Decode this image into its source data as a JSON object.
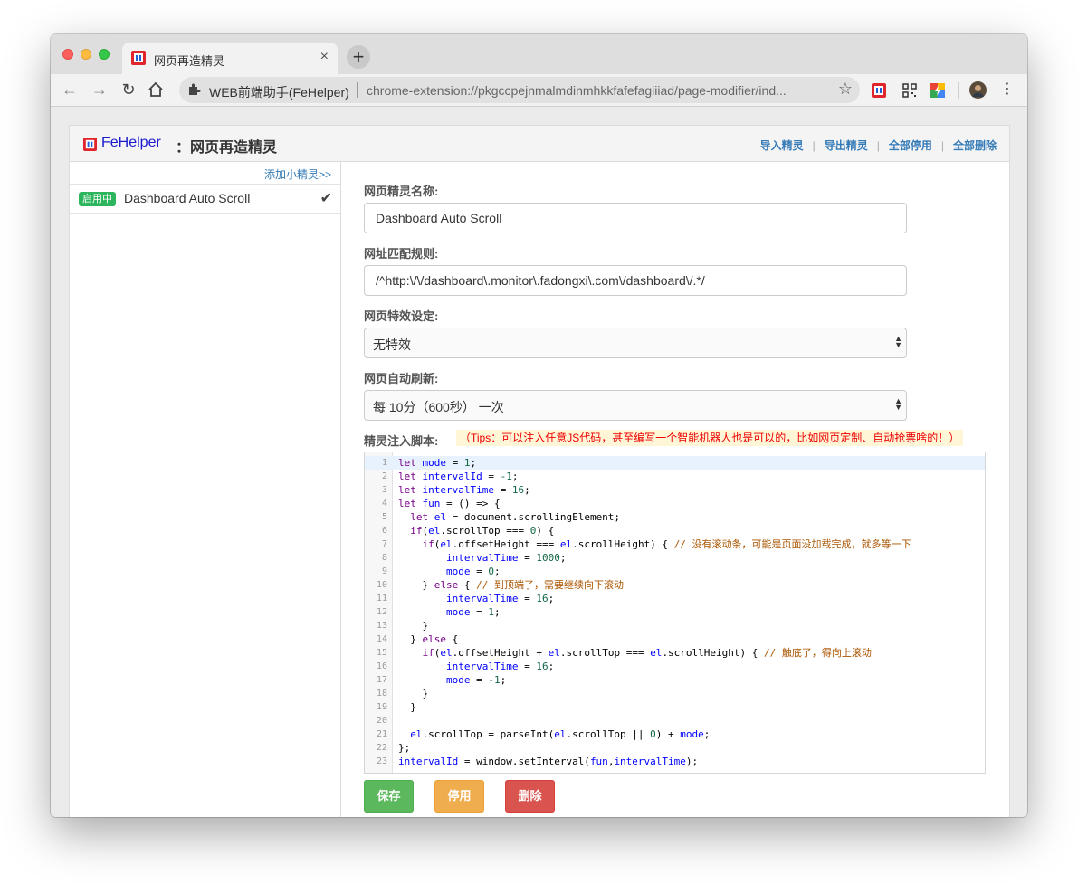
{
  "browser": {
    "tab_title": "网页再造精灵",
    "tab_close": "×",
    "new_tab": "+",
    "address": {
      "site_name": "WEB前端助手(FeHelper)",
      "url": "chrome-extension://pkgccpejnmalmdinmhkkfafefagiiiad/page-modifier/ind..."
    }
  },
  "header": {
    "brand": "FeHelper",
    "title": "：网页再造精灵",
    "links": [
      "导入精灵",
      "导出精灵",
      "全部停用",
      "全部删除"
    ]
  },
  "sidebar": {
    "add_link": "添加小精灵>>",
    "items": [
      {
        "badge": "启用中",
        "name": "Dashboard Auto Scroll",
        "check": "✔"
      }
    ]
  },
  "form": {
    "name_label": "网页精灵名称:",
    "name_value": "Dashboard Auto Scroll",
    "url_label": "网址匹配规则:",
    "url_value": "/^http:\\/\\/dashboard\\.monitor\\.fadongxi\\.com\\/dashboard\\/.*/",
    "effect_label": "网页特效设定:",
    "effect_value": "无特效",
    "refresh_label": "网页自动刷新:",
    "refresh_value": "每 10分（600秒） 一次",
    "script_label": "精灵注入脚本:",
    "tips": "（Tips：可以注入任意JS代码，甚至编写一个智能机器人也是可以的，比如网页定制、自动抢票啥的！）"
  },
  "code": [
    "let mode = 1;",
    "let intervalId = -1;",
    "let intervalTime = 16;",
    "let fun = () => {",
    "  let el = document.scrollingElement;",
    "  if(el.scrollTop === 0) {",
    "    if(el.offsetHeight === el.scrollHeight) { // 没有滚动条，可能是页面没加载完成，就多等一下",
    "        intervalTime = 1000;",
    "        mode = 0;",
    "    } else { // 到顶端了，需要继续向下滚动",
    "        intervalTime = 16;",
    "        mode = 1;",
    "    }",
    "  } else {",
    "    if(el.offsetHeight + el.scrollTop === el.scrollHeight) { // 触底了，得向上滚动",
    "        intervalTime = 16;",
    "        mode = -1;",
    "    }",
    "  }",
    "",
    "  el.scrollTop = parseInt(el.scrollTop || 0) + mode;",
    "};",
    "intervalId = window.setInterval(fun,intervalTime);"
  ],
  "buttons": {
    "save": "保存",
    "disable": "停用",
    "delete": "删除"
  }
}
